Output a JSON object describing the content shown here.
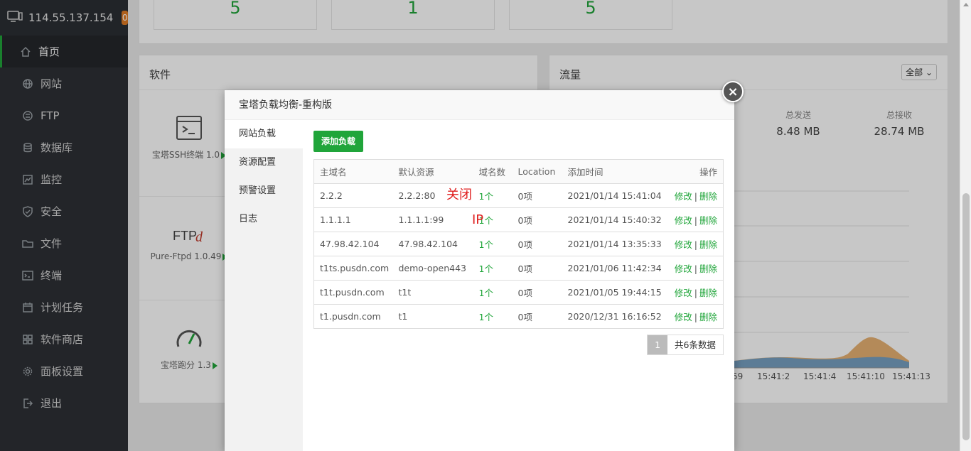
{
  "sidebar": {
    "ip": "114.55.137.154",
    "badge": "0",
    "items": [
      {
        "label": "首页"
      },
      {
        "label": "网站"
      },
      {
        "label": "FTP"
      },
      {
        "label": "数据库"
      },
      {
        "label": "监控"
      },
      {
        "label": "安全"
      },
      {
        "label": "文件"
      },
      {
        "label": "终端"
      },
      {
        "label": "计划任务"
      },
      {
        "label": "软件商店"
      },
      {
        "label": "面板设置"
      },
      {
        "label": "退出"
      }
    ]
  },
  "stats": [
    "5",
    "1",
    "5"
  ],
  "software": {
    "title": "软件",
    "items": [
      {
        "name": "宝塔SSH终端 1.0"
      },
      {
        "name": "Pure-Ftpd 1.0.49"
      },
      {
        "name": "宝塔跑分 1.3"
      }
    ]
  },
  "traffic": {
    "title": "流量",
    "select": "全部",
    "sent_label": "总发送",
    "sent_value": "8.48 MB",
    "recv_label": "总接收",
    "recv_value": "28.74 MB",
    "xticks": [
      "59",
      "15:41:2",
      "15:41:4",
      "15:41:10",
      "15:41:13"
    ]
  },
  "modal": {
    "title": "宝塔负载均衡-重构版",
    "close": "×",
    "tabs": [
      "网站负载",
      "资源配置",
      "预警设置",
      "日志"
    ],
    "add_button": "添加负载",
    "columns": [
      "主域名",
      "默认资源",
      "域名数",
      "Location",
      "添加时间",
      "操作"
    ],
    "rows": [
      {
        "domain": "2.2.2",
        "resource": "2.2.2:80",
        "count": "1个",
        "location": "0项",
        "time": "2021/01/14 15:41:04"
      },
      {
        "domain": "1.1.1.1",
        "resource": "1.1.1.1:99",
        "count": "1个",
        "location": "0项",
        "time": "2021/01/14 15:40:32"
      },
      {
        "domain": "47.98.42.104",
        "resource": "47.98.42.104",
        "count": "1个",
        "location": "0项",
        "time": "2021/01/14 13:35:33"
      },
      {
        "domain": "t1ts.pusdn.com",
        "resource": "demo-open443",
        "count": "1个",
        "location": "0项",
        "time": "2021/01/06 11:42:34"
      },
      {
        "domain": "t1t.pusdn.com",
        "resource": "t1t",
        "count": "1个",
        "location": "0项",
        "time": "2021/01/05 19:44:15"
      },
      {
        "domain": "t1.pusdn.com",
        "resource": "t1",
        "count": "1个",
        "location": "0项",
        "time": "2020/12/31 16:16:52"
      }
    ],
    "action_edit": "修改",
    "action_sep": "|",
    "action_delete": "删除",
    "pager_current": "1",
    "pager_total": "共6条数据"
  },
  "annotations": {
    "text1": "关闭",
    "text2": "IP"
  }
}
